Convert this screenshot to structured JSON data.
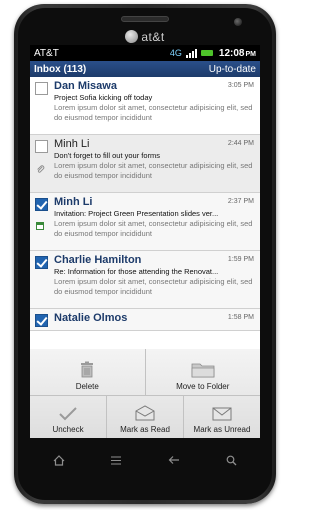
{
  "device": {
    "brand": "at&t"
  },
  "status_bar": {
    "carrier": "AT&T",
    "network": "4G",
    "time": "12:08",
    "ampm": "PM"
  },
  "inbox_bar": {
    "title": "Inbox (113)",
    "status": "Up-to-date"
  },
  "messages": [
    {
      "sender": "Dan Misawa",
      "date": "3:05 PM",
      "subject": "Project Sofia kicking off today",
      "preview": "Lorem ipsum dolor sit amet, consectetur adipisicing elit, sed do eiusmod tempor incididunt",
      "checked": false,
      "read": false
    },
    {
      "sender": "Minh Li",
      "date": "2:44 PM",
      "subject": "Don't forget to fill out your forms",
      "preview": "Lorem ipsum dolor sit amet, consectetur adipisicing elit, sed do eiusmod tempor incididunt",
      "checked": false,
      "read": true
    },
    {
      "sender": "Minh Li",
      "date": "2:37 PM",
      "subject": "Invitation: Project Green Presentation slides ver...",
      "preview": "Lorem ipsum dolor sit amet, consectetur adipisicing elit, sed do eiusmod tempor incididunt",
      "checked": true,
      "read": false
    },
    {
      "sender": "Charlie Hamilton",
      "date": "1:59 PM",
      "subject": "Re: Information for those attending the Renovat...",
      "preview": "Lorem ipsum dolor sit amet, consectetur adipisicing elit, sed do eiusmod tempor incididunt",
      "checked": true,
      "read": false
    },
    {
      "sender": "Natalie Olmos",
      "date": "1:58 PM",
      "checked": true,
      "read": false
    }
  ],
  "actions": {
    "delete": "Delete",
    "move": "Move to Folder",
    "uncheck": "Uncheck",
    "mark_read": "Mark as Read",
    "mark_unread": "Mark as Unread"
  },
  "icons": {
    "attachment": "paperclip-icon",
    "invite": "calendar-icon",
    "home": "home-icon",
    "menu": "menu-icon",
    "back": "back-icon",
    "search": "search-icon"
  },
  "colors": {
    "accent": "#2164b0",
    "header_blue": "#1d3b6a",
    "battery": "#4ec32a"
  }
}
